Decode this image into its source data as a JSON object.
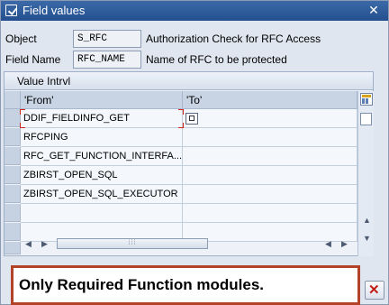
{
  "window": {
    "title": "Field values"
  },
  "header": {
    "object_label": "Object",
    "object_value": "S_RFC",
    "object_desc": "Authorization Check for RFC Access",
    "field_label": "Field Name",
    "field_value": "RFC_NAME",
    "field_desc": "Name of RFC to be protected"
  },
  "table": {
    "title": "Value Intrvl",
    "columns": [
      "'From'",
      "'To'"
    ],
    "rows": [
      {
        "from": "DDIF_FIELDINFO_GET",
        "to": ""
      },
      {
        "from": "RFCPING",
        "to": ""
      },
      {
        "from": "RFC_GET_FUNCTION_INTERFA...",
        "to": ""
      },
      {
        "from": "ZBIRST_OPEN_SQL",
        "to": ""
      },
      {
        "from": "ZBIRST_OPEN_SQL_EXECUTOR",
        "to": ""
      },
      {
        "from": "",
        "to": ""
      },
      {
        "from": "",
        "to": ""
      }
    ]
  },
  "callout": {
    "text": "Only Required Function modules."
  },
  "colors": {
    "title_bar": "#2c5b9b",
    "accent_red": "#c21d14",
    "callout_border": "#b44228"
  }
}
